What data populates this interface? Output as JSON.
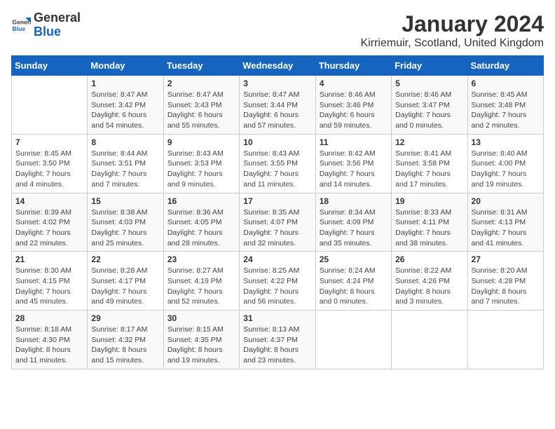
{
  "header": {
    "logo_general": "General",
    "logo_blue": "Blue",
    "title": "January 2024",
    "subtitle": "Kirriemuir, Scotland, United Kingdom"
  },
  "columns": [
    "Sunday",
    "Monday",
    "Tuesday",
    "Wednesday",
    "Thursday",
    "Friday",
    "Saturday"
  ],
  "weeks": [
    [
      {
        "num": "",
        "detail": ""
      },
      {
        "num": "1",
        "detail": "Sunrise: 8:47 AM\nSunset: 3:42 PM\nDaylight: 6 hours\nand 54 minutes."
      },
      {
        "num": "2",
        "detail": "Sunrise: 8:47 AM\nSunset: 3:43 PM\nDaylight: 6 hours\nand 55 minutes."
      },
      {
        "num": "3",
        "detail": "Sunrise: 8:47 AM\nSunset: 3:44 PM\nDaylight: 6 hours\nand 57 minutes."
      },
      {
        "num": "4",
        "detail": "Sunrise: 8:46 AM\nSunset: 3:46 PM\nDaylight: 6 hours\nand 59 minutes."
      },
      {
        "num": "5",
        "detail": "Sunrise: 8:46 AM\nSunset: 3:47 PM\nDaylight: 7 hours\nand 0 minutes."
      },
      {
        "num": "6",
        "detail": "Sunrise: 8:45 AM\nSunset: 3:48 PM\nDaylight: 7 hours\nand 2 minutes."
      }
    ],
    [
      {
        "num": "7",
        "detail": "Sunrise: 8:45 AM\nSunset: 3:50 PM\nDaylight: 7 hours\nand 4 minutes."
      },
      {
        "num": "8",
        "detail": "Sunrise: 8:44 AM\nSunset: 3:51 PM\nDaylight: 7 hours\nand 7 minutes."
      },
      {
        "num": "9",
        "detail": "Sunrise: 8:43 AM\nSunset: 3:53 PM\nDaylight: 7 hours\nand 9 minutes."
      },
      {
        "num": "10",
        "detail": "Sunrise: 8:43 AM\nSunset: 3:55 PM\nDaylight: 7 hours\nand 11 minutes."
      },
      {
        "num": "11",
        "detail": "Sunrise: 8:42 AM\nSunset: 3:56 PM\nDaylight: 7 hours\nand 14 minutes."
      },
      {
        "num": "12",
        "detail": "Sunrise: 8:41 AM\nSunset: 3:58 PM\nDaylight: 7 hours\nand 17 minutes."
      },
      {
        "num": "13",
        "detail": "Sunrise: 8:40 AM\nSunset: 4:00 PM\nDaylight: 7 hours\nand 19 minutes."
      }
    ],
    [
      {
        "num": "14",
        "detail": "Sunrise: 8:39 AM\nSunset: 4:02 PM\nDaylight: 7 hours\nand 22 minutes."
      },
      {
        "num": "15",
        "detail": "Sunrise: 8:38 AM\nSunset: 4:03 PM\nDaylight: 7 hours\nand 25 minutes."
      },
      {
        "num": "16",
        "detail": "Sunrise: 8:36 AM\nSunset: 4:05 PM\nDaylight: 7 hours\nand 28 minutes."
      },
      {
        "num": "17",
        "detail": "Sunrise: 8:35 AM\nSunset: 4:07 PM\nDaylight: 7 hours\nand 32 minutes."
      },
      {
        "num": "18",
        "detail": "Sunrise: 8:34 AM\nSunset: 4:09 PM\nDaylight: 7 hours\nand 35 minutes."
      },
      {
        "num": "19",
        "detail": "Sunrise: 8:33 AM\nSunset: 4:11 PM\nDaylight: 7 hours\nand 38 minutes."
      },
      {
        "num": "20",
        "detail": "Sunrise: 8:31 AM\nSunset: 4:13 PM\nDaylight: 7 hours\nand 41 minutes."
      }
    ],
    [
      {
        "num": "21",
        "detail": "Sunrise: 8:30 AM\nSunset: 4:15 PM\nDaylight: 7 hours\nand 45 minutes."
      },
      {
        "num": "22",
        "detail": "Sunrise: 8:28 AM\nSunset: 4:17 PM\nDaylight: 7 hours\nand 49 minutes."
      },
      {
        "num": "23",
        "detail": "Sunrise: 8:27 AM\nSunset: 4:19 PM\nDaylight: 7 hours\nand 52 minutes."
      },
      {
        "num": "24",
        "detail": "Sunrise: 8:25 AM\nSunset: 4:22 PM\nDaylight: 7 hours\nand 56 minutes."
      },
      {
        "num": "25",
        "detail": "Sunrise: 8:24 AM\nSunset: 4:24 PM\nDaylight: 8 hours\nand 0 minutes."
      },
      {
        "num": "26",
        "detail": "Sunrise: 8:22 AM\nSunset: 4:26 PM\nDaylight: 8 hours\nand 3 minutes."
      },
      {
        "num": "27",
        "detail": "Sunrise: 8:20 AM\nSunset: 4:28 PM\nDaylight: 8 hours\nand 7 minutes."
      }
    ],
    [
      {
        "num": "28",
        "detail": "Sunrise: 8:18 AM\nSunset: 4:30 PM\nDaylight: 8 hours\nand 11 minutes."
      },
      {
        "num": "29",
        "detail": "Sunrise: 8:17 AM\nSunset: 4:32 PM\nDaylight: 8 hours\nand 15 minutes."
      },
      {
        "num": "30",
        "detail": "Sunrise: 8:15 AM\nSunset: 4:35 PM\nDaylight: 8 hours\nand 19 minutes."
      },
      {
        "num": "31",
        "detail": "Sunrise: 8:13 AM\nSunset: 4:37 PM\nDaylight: 8 hours\nand 23 minutes."
      },
      {
        "num": "",
        "detail": ""
      },
      {
        "num": "",
        "detail": ""
      },
      {
        "num": "",
        "detail": ""
      }
    ]
  ]
}
